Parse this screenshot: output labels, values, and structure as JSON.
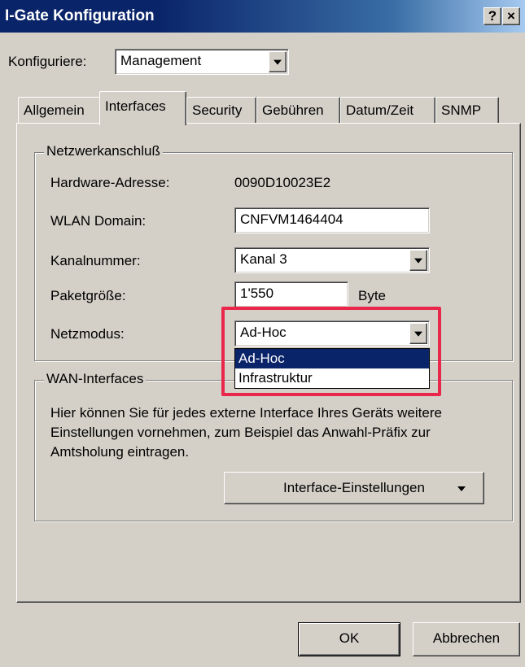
{
  "window": {
    "title": "I-Gate Konfiguration",
    "help_label": "?",
    "close_label": "×"
  },
  "configure": {
    "label": "Konfiguriere:",
    "value": "Management"
  },
  "tabs": [
    {
      "label": "Allgemein",
      "active": false
    },
    {
      "label": "Interfaces",
      "active": true
    },
    {
      "label": "Security",
      "active": false
    },
    {
      "label": "Gebühren",
      "active": false
    },
    {
      "label": "Datum/Zeit",
      "active": false
    },
    {
      "label": "SNMP",
      "active": false
    }
  ],
  "network": {
    "group_title": "Netzwerkanschluß",
    "hardware_label": "Hardware-Adresse:",
    "hardware_value": "0090D10023E2",
    "wlan_label": "WLAN Domain:",
    "wlan_value": "CNFVM1464404",
    "channel_label": "Kanalnummer:",
    "channel_value": "Kanal 3",
    "packet_label": "Paketgröße:",
    "packet_value": "1'550",
    "packet_unit": "Byte",
    "mode_label": "Netzmodus:",
    "mode_value": "Ad-Hoc",
    "mode_options": [
      "Ad-Hoc",
      "Infrastruktur"
    ]
  },
  "wan": {
    "group_title": "WAN-Interfaces",
    "description": "Hier können Sie für jedes externe Interface Ihres Geräts weitere Einstellungen vornehmen, zum Beispiel das Anwahl-Präfix zur Amtsholung eintragen.",
    "settings_button": "Interface-Einstellungen"
  },
  "footer": {
    "ok_label": "OK",
    "cancel_label": "Abbrechen"
  },
  "colors": {
    "highlight": "#e8274b",
    "selection": "#0a246a",
    "face": "#d4d0c8"
  }
}
